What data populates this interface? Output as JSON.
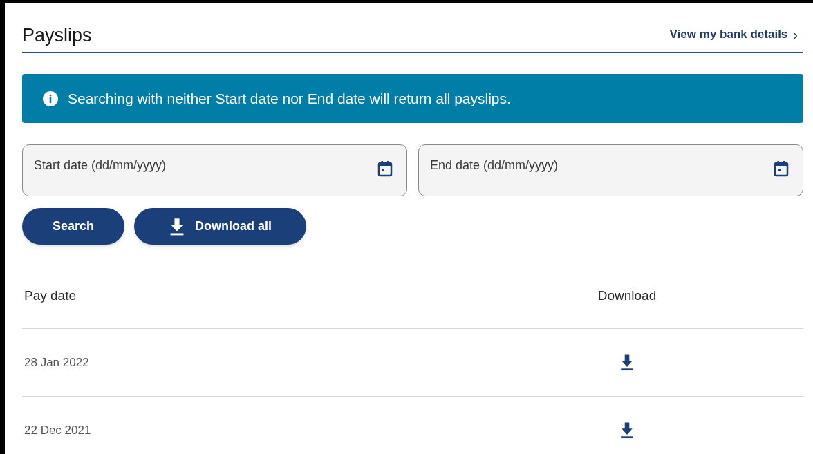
{
  "header": {
    "title": "Payslips",
    "link": "View my bank details",
    "link_chevron": "›"
  },
  "banner": {
    "text": "Searching with neither Start date nor End date will return all payslips."
  },
  "fields": [
    {
      "placeholder": "Start date (dd/mm/yyyy)"
    },
    {
      "placeholder": "End date (dd/mm/yyyy)"
    }
  ],
  "buttons": [
    {
      "label": "Search",
      "kind": "plain"
    },
    {
      "label": "Download all",
      "kind": "download"
    }
  ],
  "table": {
    "columns": [
      "Pay date",
      "Download"
    ],
    "rows": [
      {
        "pay_date": "28 Jan 2022"
      },
      {
        "pay_date": "22 Dec 2021"
      }
    ]
  }
}
